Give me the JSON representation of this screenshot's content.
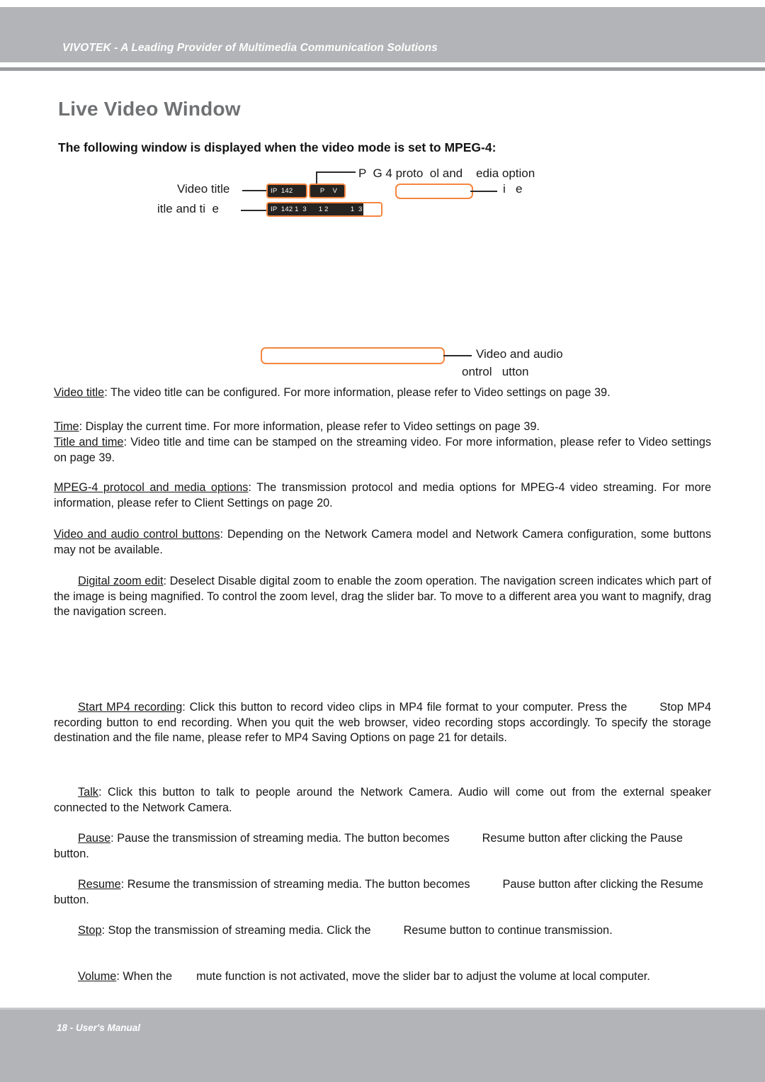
{
  "header": {
    "banner_text": "VIVOTEK - A Leading Provider of Multimedia Communication Solutions",
    "band_color": "#b2b4b7"
  },
  "page": {
    "title": "Live Video Window",
    "title_color": "#6f7173",
    "subtitle": "The following window is displayed when the video mode is set to MPEG-4:"
  },
  "figure": {
    "accent_color": "#f5853f",
    "callouts": {
      "video_title": "Video title",
      "title_and_time": "itle and ti  e",
      "mpeg_protocol": "P  G 4 proto  ol and    edia option",
      "time": "i   e",
      "video_audio_control_line1": "Video and audio",
      "video_audio_control_line2": "ontrol   utton"
    },
    "statusbars": {
      "title_bar": "IP  142",
      "codec_bar": "P    V",
      "title_time_bar": "IP  142 1  3      1 2           1  3"
    }
  },
  "body": {
    "video_title": {
      "term": "Video title",
      "text": ": The video title can be configured. For more information, please refer to Video settings on page 39."
    },
    "time": {
      "term": "Time",
      "text": ": Display the current time. For more information, please refer to Video settings on page 39."
    },
    "title_and_time": {
      "term": "Title and time",
      "text": ": Video title and time can be stamped on the streaming video. For more information, please refer to Video settings on page 39."
    },
    "mpeg4_protocol": {
      "term": "MPEG-4 protocol and media options",
      "text": ": The transmission protocol and media options for MPEG-4 video streaming. For more information, please refer to Client Settings on page 20."
    },
    "video_audio_buttons": {
      "term": "Video and audio control buttons",
      "text": ": Depending on the Network Camera model and Network Camera configuration, some buttons may not be available."
    },
    "digital_zoom": {
      "term": "Digital zoom edit",
      "text": ": Deselect Disable digital zoom to enable the zoom operation. The navigation screen indicates which part of the image is being magnified. To control the zoom level, drag the slider bar. To move to a different area you want to magnify, drag the navigation screen."
    },
    "start_mp4": {
      "term": "Start MP4 recording",
      "text_a": ": Click this button to record video clips in MP4 file format to your computer. Press the",
      "text_b": "Stop MP4 recording button to end recording. When you quit the web browser, video recording stops accordingly. To specify the storage destination and the file name, please refer to MP4 Saving Options on page 21 for details."
    },
    "talk": {
      "term": "Talk",
      "text": ": Click this button to talk to people around the Network Camera. Audio will come out from the external speaker connected to the Network Camera."
    },
    "pause": {
      "term": "Pause",
      "text_a": ": Pause the transmission of streaming media. The button becomes",
      "text_b": "Resume button after clicking the Pause button."
    },
    "resume": {
      "term": "Resume",
      "text_a": ": Resume the transmission of streaming media. The button becomes",
      "text_b": "Pause button after clicking the Resume button."
    },
    "stop": {
      "term": "Stop",
      "text_a": ": Stop the transmission of streaming media. Click the",
      "text_b": "Resume button to continue transmission."
    },
    "volume": {
      "term": "Volume",
      "text_a": ": When the",
      "text_b": "mute function is not activated, move the slider bar to adjust the volume at local computer."
    }
  },
  "footer": {
    "text": "18 - User's Manual",
    "band_color": "#b2b4b7"
  }
}
